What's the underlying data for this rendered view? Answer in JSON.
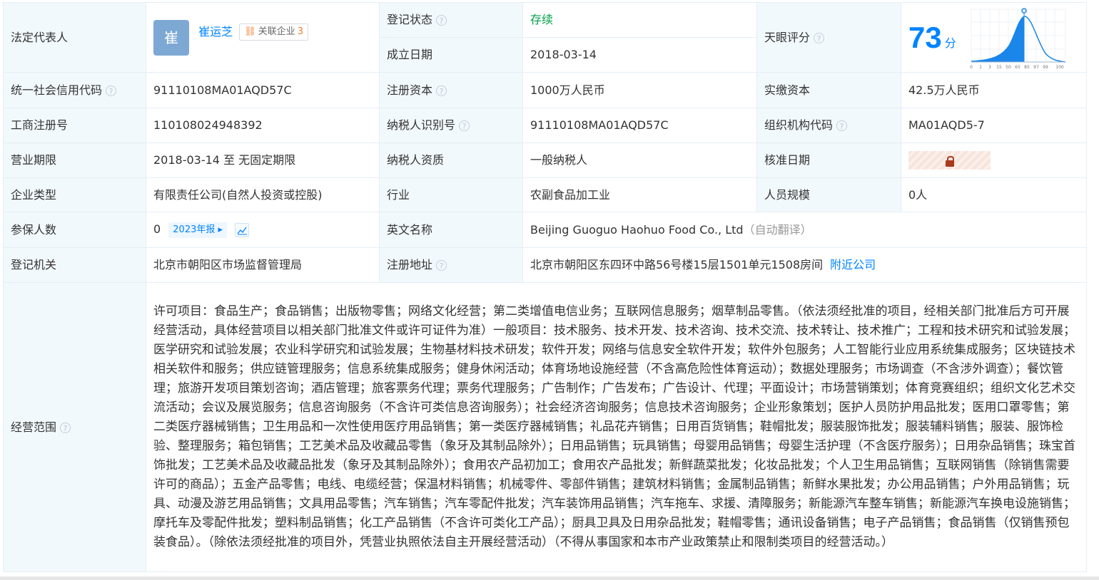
{
  "legal_rep": {
    "label": "法定代表人",
    "avatar_char": "崔",
    "name": "崔运芝",
    "related_label": "关联企业",
    "related_count": "3"
  },
  "reg_status": {
    "label": "登记状态",
    "value": "存续"
  },
  "found_date": {
    "label": "成立日期",
    "value": "2018-03-14"
  },
  "tianyan_score": {
    "label": "天眼评分",
    "value": "73",
    "unit": "分",
    "axis_ticks": [
      "0",
      "1",
      "3",
      "15",
      "50",
      "65",
      "85",
      "97",
      "99",
      "100"
    ]
  },
  "rows": [
    {
      "l1": "统一社会信用代码",
      "v1": "91110108MA01AQD57C",
      "l2": "注册资本",
      "v2": "1000万人民币",
      "l3": "实缴资本",
      "v3": "42.5万人民币"
    },
    {
      "l1": "工商注册号",
      "v1": "110108024948392",
      "l2": "纳税人识别号",
      "v2": "91110108MA01AQD57C",
      "l3": "组织机构代码",
      "v3": "MA01AQD5-7"
    },
    {
      "l1": "营业期限",
      "v1": "2018-03-14 至 无固定期限",
      "l2": "纳税人资质",
      "v2": "一般纳税人",
      "l3": "核准日期",
      "v3": ""
    },
    {
      "l1": "企业类型",
      "v1": "有限责任公司(自然人投资或控股)",
      "l2": "行业",
      "v2": "农副食品加工业",
      "l3": "人员规模",
      "v3": "0人"
    }
  ],
  "insured": {
    "label": "参保人数",
    "value": "0",
    "year_btn": "2023年报"
  },
  "english_name": {
    "label": "英文名称",
    "value": "Beijing Guoguo Haohuo Food Co., Ltd",
    "note": "（自动翻译）"
  },
  "reg_authority": {
    "label": "登记机关",
    "value": "北京市朝阳区市场监督管理局"
  },
  "reg_address": {
    "label": "注册地址",
    "value": "北京市朝阳区东四环中路56号楼15层1501单元1508房间",
    "nearby": "附近公司"
  },
  "business_scope": {
    "label": "经营范围",
    "text": "许可项目：食品生产；食品销售；出版物零售；网络文化经营；第二类增值电信业务；互联网信息服务；烟草制品零售。（依法须经批准的项目，经相关部门批准后方可开展经营活动，具体经营项目以相关部门批准文件或许可证件为准）一般项目：技术服务、技术开发、技术咨询、技术交流、技术转让、技术推广；工程和技术研究和试验发展；医学研究和试验发展；农业科学研究和试验发展；生物基材料技术研发；软件开发；网络与信息安全软件开发；软件外包服务；人工智能行业应用系统集成服务；区块链技术相关软件和服务；供应链管理服务；信息系统集成服务；健身休闲活动；体育场地设施经营（不含高危险性体育运动）；数据处理服务；市场调查（不含涉外调查）；餐饮管理；旅游开发项目策划咨询；酒店管理；旅客票务代理；票务代理服务；广告制作；广告发布；广告设计、代理；平面设计；市场营销策划；体育竞赛组织；组织文化艺术交流活动；会议及展览服务；信息咨询服务（不含许可类信息咨询服务）；社会经济咨询服务；信息技术咨询服务；企业形象策划；医护人员防护用品批发；医用口罩零售；第二类医疗器械销售；卫生用品和一次性使用医疗用品销售；第一类医疗器械销售；礼品花卉销售；日用百货销售；鞋帽批发；服装服饰批发；服装辅料销售；服装、服饰检验、整理服务；箱包销售；工艺美术品及收藏品零售（象牙及其制品除外）；日用品销售；玩具销售；母婴用品销售；母婴生活护理（不含医疗服务）；日用杂品销售；珠宝首饰批发；工艺美术品及收藏品批发（象牙及其制品除外）；食用农产品初加工；食用农产品批发；新鲜蔬菜批发；化妆品批发；个人卫生用品销售；互联网销售（除销售需要许可的商品）；五金产品零售；电线、电缆经营；保温材料销售；机械零件、零部件销售；建筑材料销售；金属制品销售；新鲜水果批发；办公用品销售；户外用品销售；玩具、动漫及游艺用品销售；文具用品零售；汽车销售；汽车零配件批发；汽车装饰用品销售；汽车拖车、求援、清障服务；新能源汽车整车销售；新能源汽车换电设施销售；摩托车及零配件批发；塑料制品销售；化工产品销售（不含许可类化工产品）；厨具卫具及日用杂品批发；鞋帽零售；通讯设备销售；电子产品销售；食品销售（仅销售预包装食品）。（除依法须经批准的项目外，凭营业执照依法自主开展经营活动）（不得从事国家和本市产业政策禁止和限制类项目的经营活动。）"
  },
  "icons": [
    "help-circle-icon",
    "related-company-icon",
    "trend-chart-icon",
    "lock-icon"
  ]
}
